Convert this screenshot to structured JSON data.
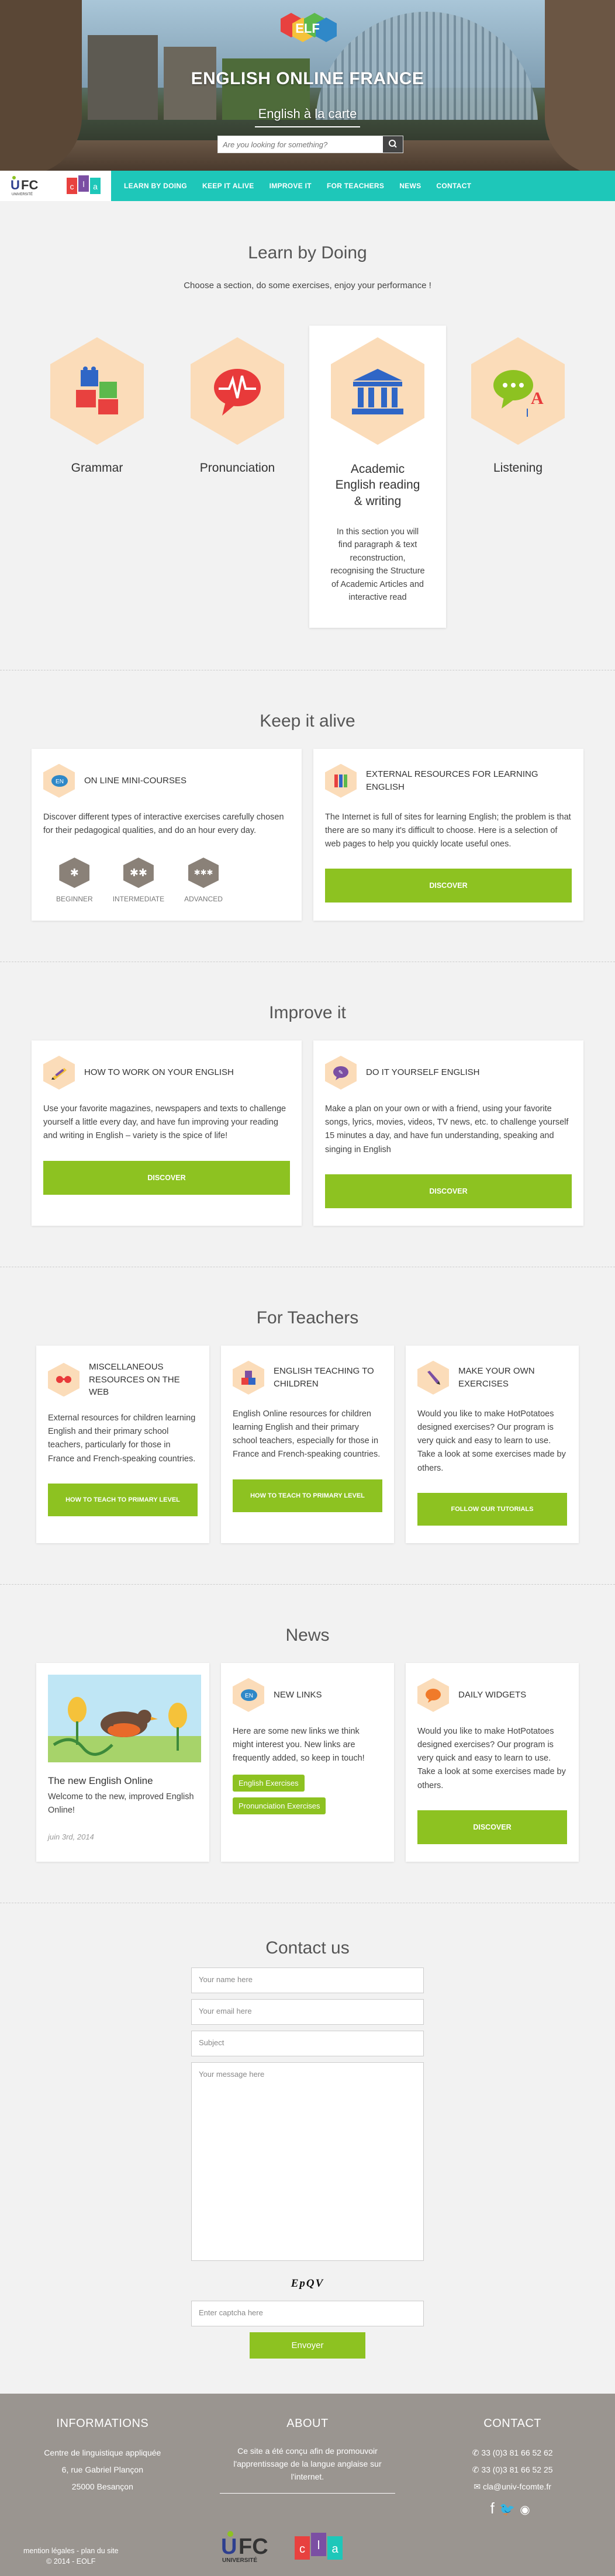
{
  "header": {
    "title": "ENGLISH ONLINE FRANCE",
    "subtitle": "English à la carte",
    "search_placeholder": "Are you looking for something?"
  },
  "nav": {
    "items": [
      "LEARN BY DOING",
      "KEEP IT ALIVE",
      "IMPROVE IT",
      "FOR TEACHERS",
      "NEWS",
      "CONTACT"
    ]
  },
  "learn": {
    "title": "Learn by Doing",
    "intro": "Choose a section, do some exercises, enjoy your performance !",
    "items": [
      {
        "label": "Grammar"
      },
      {
        "label": "Pronunciation"
      },
      {
        "label": "Academic English reading & writing",
        "desc": "In this section you will find paragraph & text reconstruction, recognising the Structure of Academic Articles and interactive read"
      },
      {
        "label": "Listening"
      }
    ]
  },
  "keep": {
    "title": "Keep it alive",
    "minicourses": {
      "title": "ON LINE MINI-COURSES",
      "text": "Discover different types of interactive exercises carefully chosen for their pedagogical qualities, and do an hour every day.",
      "levels": [
        "BEGINNER",
        "INTERMEDIATE",
        "ADVANCED"
      ]
    },
    "external": {
      "title": "EXTERNAL RESOURCES FOR LEARNING ENGLISH",
      "text": "The Internet is full of sites for learning English; the problem is that there are so many it's difficult to choose. Here is a selection of web pages to help you quickly locate useful ones.",
      "button": "DISCOVER"
    }
  },
  "improve": {
    "title": "Improve it",
    "work": {
      "title": "HOW TO WORK ON YOUR ENGLISH",
      "text": "Use your favorite magazines, newspapers and texts  to challenge yourself a little every day, and have fun improving your reading and writing in English – variety is the spice of life!",
      "button": "DISCOVER"
    },
    "diy": {
      "title": "DO IT YOURSELF ENGLISH",
      "text": "Make a plan on your own or with a friend, using your favorite songs, lyrics, movies, videos, TV news, etc. to challenge yourself 15 minutes a day, and have fun understanding, speaking and singing in English",
      "button": "DISCOVER"
    }
  },
  "teachers": {
    "title": "For Teachers",
    "cards": [
      {
        "title": "MISCELLANEOUS RESOURCES ON THE WEB",
        "text": "External resources for children learning English and their primary school teachers, particularly for those in France and French-speaking countries.",
        "button": "HOW TO TEACH TO PRIMARY LEVEL"
      },
      {
        "title": "ENGLISH TEACHING TO CHILDREN",
        "text": "English Online resources for children learning English and their primary school teachers, especially for those in France and French-speaking countries.",
        "button": "HOW TO TEACH TO PRIMARY LEVEL"
      },
      {
        "title": "MAKE YOUR OWN EXERCISES",
        "text": "Would you like to make HotPotatoes designed exercises? Our program is very quick and easy to learn to use. Take a look at some exercises made by others.",
        "button": "FOLLOW OUR TUTORIALS"
      }
    ]
  },
  "news": {
    "title": "News",
    "post": {
      "title": "The new English Online",
      "text": "Welcome to the new, improved English Online!",
      "date": "juin 3rd, 2014"
    },
    "links": {
      "title": "NEW LINKS",
      "text": "Here are some new links we think might interest you. New links are frequently added, so keep in touch!",
      "tags": [
        "English Exercises",
        "Pronunciation Exercises"
      ]
    },
    "widgets": {
      "title": "DAILY WIDGETS",
      "text": "Would you like to make HotPotatoes designed exercises? Our program is very quick and easy to learn to use. Take a look at some exercises made by others.",
      "button": "DISCOVER"
    }
  },
  "contact": {
    "title": "Contact us",
    "name": "Your name here",
    "email": "Your email here",
    "subject": "Subject",
    "message": "Your message here",
    "captcha": "EpQV",
    "captcha_placeholder": "Enter captcha here",
    "send": "Envoyer"
  },
  "footer": {
    "info": {
      "title": "INFORMATIONS",
      "lines": [
        "Centre de linguistique appliquée",
        "6, rue Gabriel Plançon",
        "25000 Besançon"
      ]
    },
    "about": {
      "title": "ABOUT",
      "text": "Ce site a été conçu afin de promouvoir l'apprentissage de la langue anglaise sur l'internet."
    },
    "contact": {
      "title": "CONTACT",
      "phone1": "33 (0)3 81 66 52 62",
      "phone2": "33 (0)3 81 66 52 25",
      "email": "cla@univ-fcomte.fr"
    },
    "legal": "mention légales - plan du site",
    "copyright": "© 2014 - EOLF"
  },
  "brand": {
    "ufc": "UFC",
    "cla": "cla",
    "universite": "UNIVERSITÉ"
  },
  "colors": {
    "accent": "#1ec7b9",
    "green": "#8dc221",
    "hex": "#fbdcb9",
    "footer": "#9a9590"
  }
}
